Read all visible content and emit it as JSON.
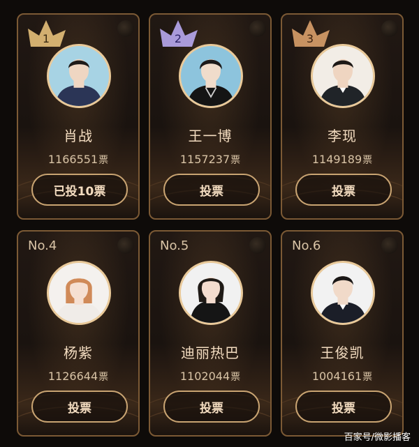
{
  "unit": "票",
  "cards": [
    {
      "name": "肖战",
      "votes": "1166551",
      "button": "已投10票",
      "rank": "1",
      "crown_color": "#e6c07a",
      "shirt": "#2b3556",
      "bg": "#a7d3e4",
      "hair": "#1e1a18"
    },
    {
      "name": "王一博",
      "votes": "1157237",
      "button": "投票",
      "rank": "2",
      "crown_color": "#b8a8f0",
      "shirt": "#141414",
      "bg": "#8dc4dd",
      "hair": "#1c1a1a"
    },
    {
      "name": "李现",
      "votes": "1149189",
      "button": "投票",
      "rank": "3",
      "crown_color": "#d9a06a",
      "shirt": "#202428",
      "bg": "#f2ede6",
      "hair": "#1c1816"
    },
    {
      "name": "杨紫",
      "votes": "1126644",
      "button": "投票",
      "rank_label": "No.4",
      "shirt": "#f0ece8",
      "bg": "#f4f1ee",
      "hair": "#d08a58"
    },
    {
      "name": "迪丽热巴",
      "votes": "1102044",
      "button": "投票",
      "rank_label": "No.5",
      "shirt": "#151515",
      "bg": "#f1f1f1",
      "hair": "#1f1a16"
    },
    {
      "name": "王俊凯",
      "votes": "1004161",
      "button": "投票",
      "rank_label": "No.6",
      "shirt": "#1b1e28",
      "bg": "#f2f2f2",
      "hair": "#1a1716"
    }
  ],
  "watermark": "百家号/微影播客"
}
